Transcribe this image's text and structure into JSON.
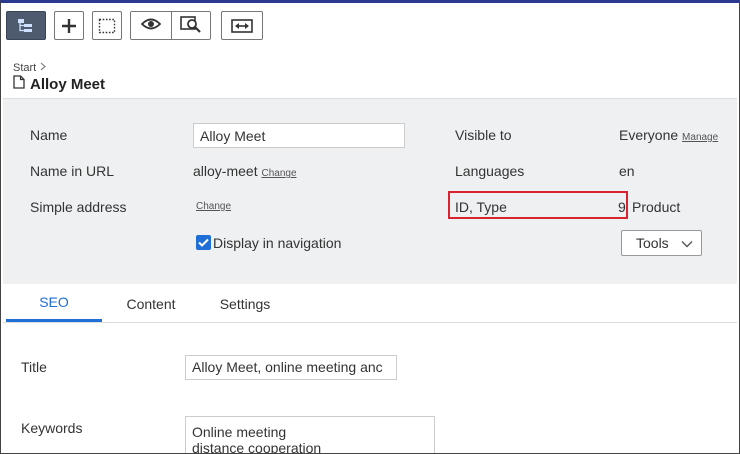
{
  "toolbar": {
    "buttons": [
      {
        "name": "structure-toggle",
        "icon": "page-tree-icon"
      },
      {
        "name": "add",
        "icon": "plus-icon"
      },
      {
        "name": "select",
        "icon": "dotted-selection-icon"
      },
      {
        "name": "view-mode",
        "icon": "eye-icon"
      },
      {
        "name": "preview",
        "icon": "magnify-preview-icon"
      },
      {
        "name": "compare",
        "icon": "compare-arrows-icon"
      }
    ]
  },
  "header": {
    "breadcrumb": "Start",
    "title": "Alloy Meet"
  },
  "panel": {
    "name_label": "Name",
    "name_value": "Alloy Meet",
    "name_url_label": "Name in URL",
    "name_url_value": "alloy-meet",
    "name_url_change": "Change",
    "simple_address_label": "Simple address",
    "simple_address_change": "Change",
    "display_in_nav_label": "Display in navigation",
    "display_in_nav_checked": true,
    "visible_to_label": "Visible to",
    "visible_to_value": "Everyone",
    "visible_to_manage": "Manage",
    "languages_label": "Languages",
    "languages_value": "en",
    "id_type_label": "ID, Type",
    "id_value": "9",
    "type_value": "Product",
    "tools_label": "Tools",
    "highlight_color": "#d9232e"
  },
  "tabs": [
    {
      "label": "SEO",
      "active": true
    },
    {
      "label": "Content",
      "active": false
    },
    {
      "label": "Settings",
      "active": false
    }
  ],
  "form": {
    "title_label": "Title",
    "title_value": "Alloy Meet, online meeting anc",
    "keywords_label": "Keywords",
    "keywords_value": "Online meeting\ndistance cooperation"
  },
  "colors": {
    "accent": "#1f6fd6",
    "top_border": "#2b3a8e",
    "active_toolbar": "#4e5a6e"
  }
}
